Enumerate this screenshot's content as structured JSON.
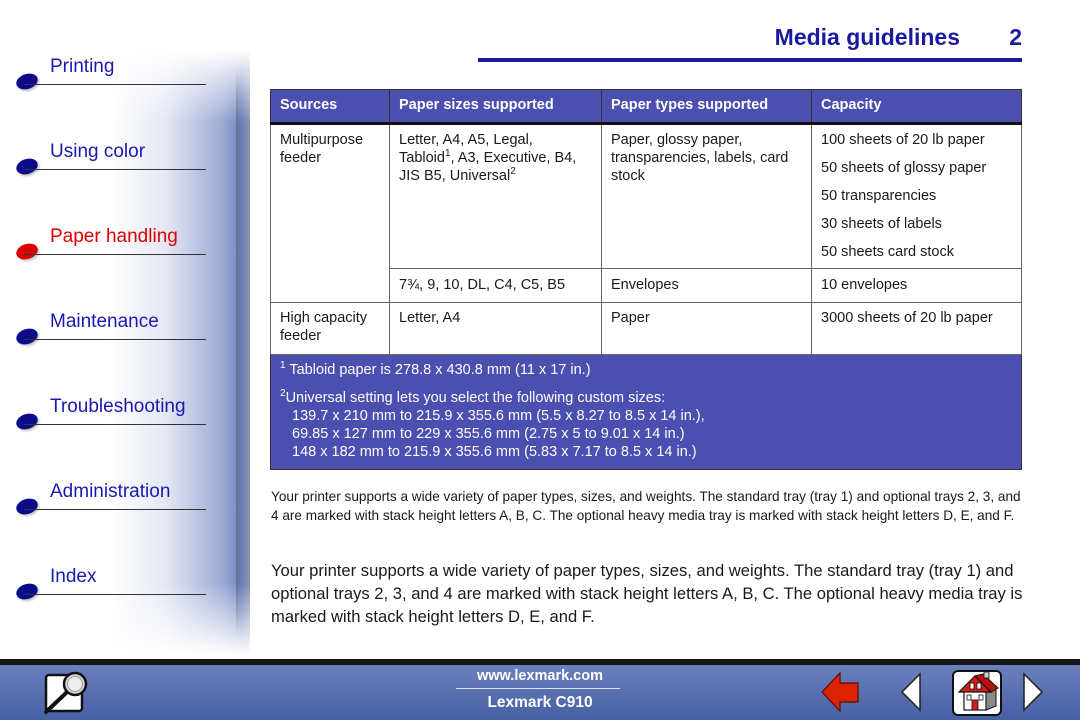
{
  "sidebar": {
    "items": [
      {
        "label": "Printing",
        "active": false
      },
      {
        "label": "Using color",
        "active": false
      },
      {
        "label": "Paper handling",
        "active": true
      },
      {
        "label": "Maintenance",
        "active": false
      },
      {
        "label": "Troubleshooting",
        "active": false
      },
      {
        "label": "Administration",
        "active": false
      },
      {
        "label": "Index",
        "active": false
      }
    ]
  },
  "header": {
    "title": "Media guidelines",
    "page_number": "2"
  },
  "table": {
    "headers": [
      "Sources",
      "Paper sizes supported",
      "Paper types supported",
      "Capacity"
    ],
    "rows": [
      {
        "source": "Multipurpose feeder",
        "sizes_part1": "Letter, A4, A5, Legal, Tabloid",
        "sizes_sup1": "1",
        "sizes_part2": ", A3, Executive, B4, JIS B5, Universal",
        "sizes_sup2": "2",
        "types": "Paper, glossy paper, transparencies, labels, card stock",
        "capacity": [
          "100 sheets of 20 lb paper",
          "50 sheets of glossy paper",
          "50 transparencies",
          "30 sheets of labels",
          "50 sheets card stock"
        ]
      },
      {
        "source": "",
        "sizes": "7¾, 9, 10, DL, C4, C5, B5",
        "types": "Envelopes",
        "capacity": [
          "10 envelopes"
        ]
      },
      {
        "source": "High capacity feeder",
        "sizes": "Letter, A4",
        "types": "Paper",
        "capacity": [
          "3000 sheets of 20 lb paper"
        ]
      }
    ],
    "notes": [
      {
        "marker": "1",
        "text": "Tabloid paper is 278.8 x 430.8 mm (11 x 17 in.)"
      },
      {
        "marker": "2",
        "text": "Universal setting lets you select the following custom sizes:",
        "lines": [
          "139.7 x 210 mm to 215.9 x 355.6 mm (5.5 x 8.27 to 8.5 x 14 in.),",
          "69.85 x 127 mm to 229 x 355.6 mm (2.75 x 5 to 9.01 x 14 in.)",
          "148 x 182 mm to 215.9 x 355.6 mm (5.83 x 7.17 to 8.5 x 14 in.)"
        ]
      }
    ]
  },
  "body": {
    "paragraph_small": "Your printer supports a wide variety of paper types, sizes, and weights. The standard tray (tray 1) and optional trays 2, 3, and 4 are marked with stack height letters A, B, C. The optional heavy media tray is marked with stack height letters D, E, and F.",
    "paragraph_large": "Your printer supports a wide variety of paper types, sizes, and weights. The standard tray (tray 1) and optional trays 2, 3, and 4 are marked with stack height letters A, B, C. The optional heavy media tray is marked with stack height letters D, E, and F."
  },
  "footer": {
    "url": "www.lexmark.com",
    "product": "Lexmark C910",
    "icons": {
      "search": "magnifier-icon",
      "back": "back-arrow-icon",
      "previous": "previous-page-icon",
      "home": "home-icon",
      "next": "next-page-icon"
    }
  },
  "colors": {
    "nav_text": "#1a1ab0",
    "nav_active": "#dd0000",
    "title": "#1a1aa0",
    "table_header": "#4b4fb0",
    "footer": "#5970b0",
    "back_arrow": "#dd2200"
  }
}
